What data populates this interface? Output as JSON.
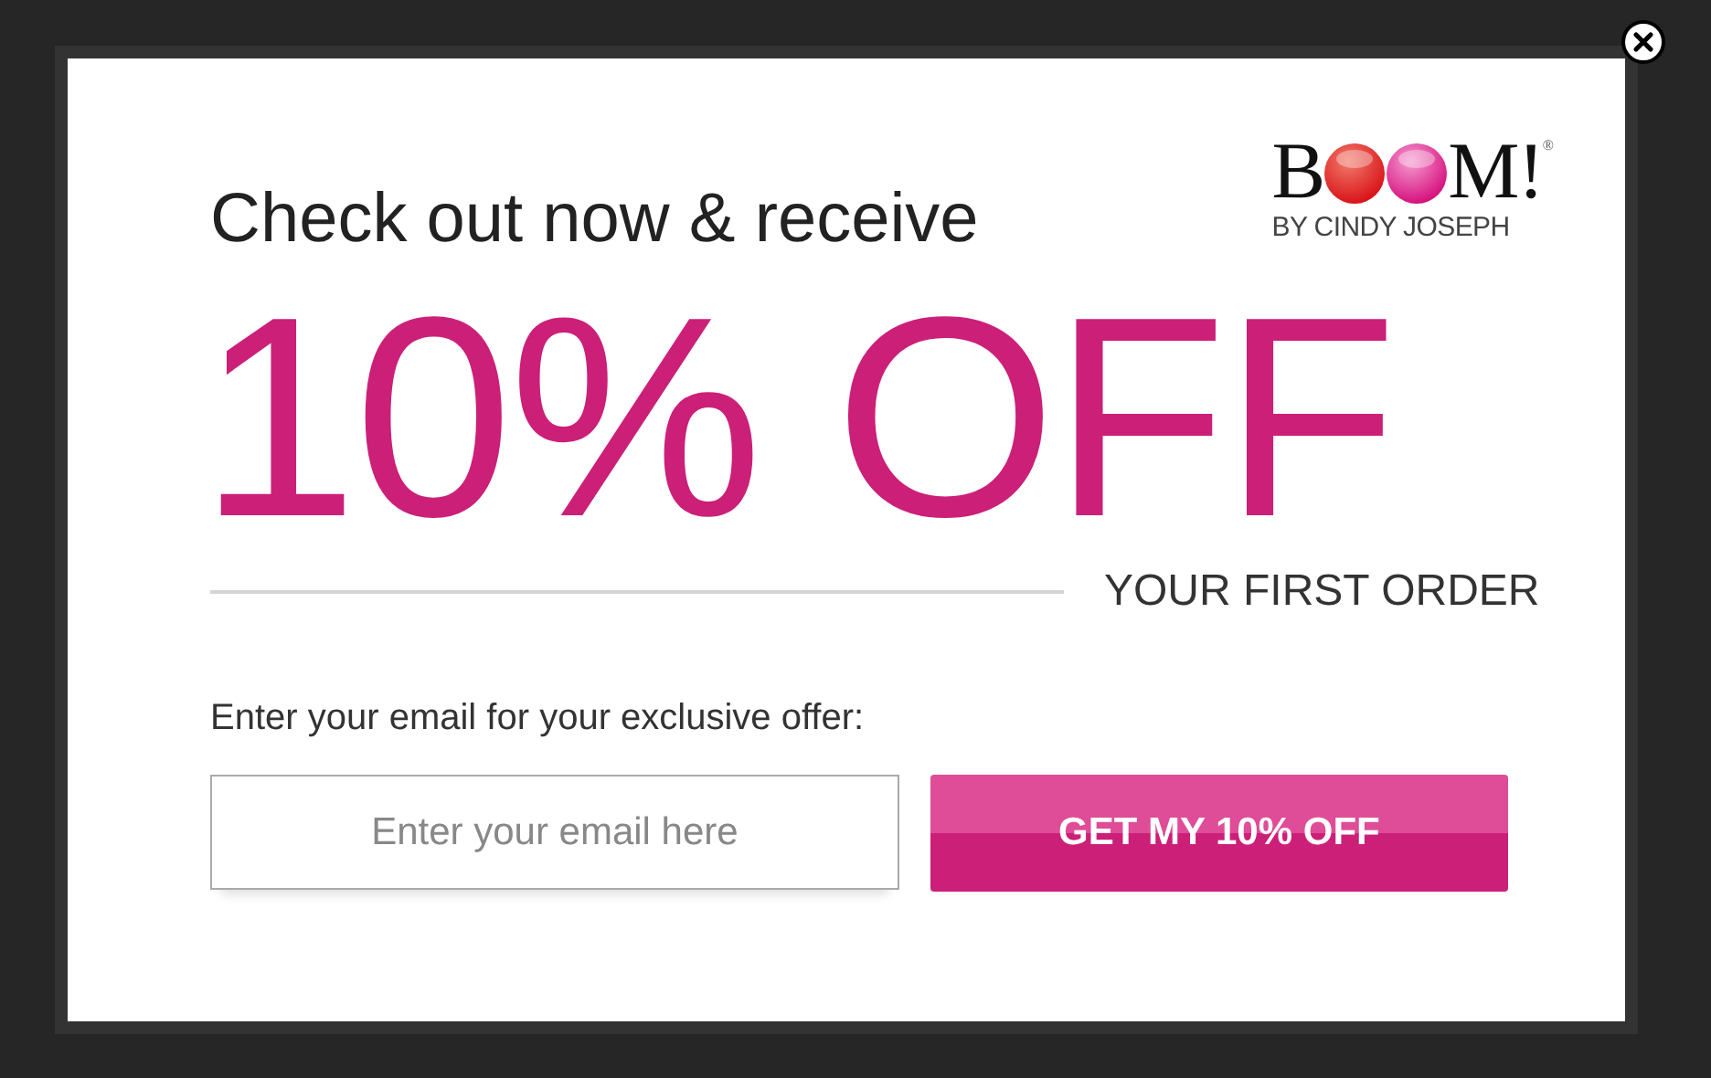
{
  "logo": {
    "first_letter": "B",
    "last_letters": "M!",
    "registered": "®",
    "tagline": "BY CINDY JOSEPH"
  },
  "headline": "Check out now & receive",
  "offer": "10% OFF",
  "offer_note": "YOUR FIRST ORDER",
  "email_label": "Enter your email for your exclusive offer:",
  "email_field": {
    "placeholder": "Enter your email here"
  },
  "submit_button": "GET MY 10% OFF"
}
